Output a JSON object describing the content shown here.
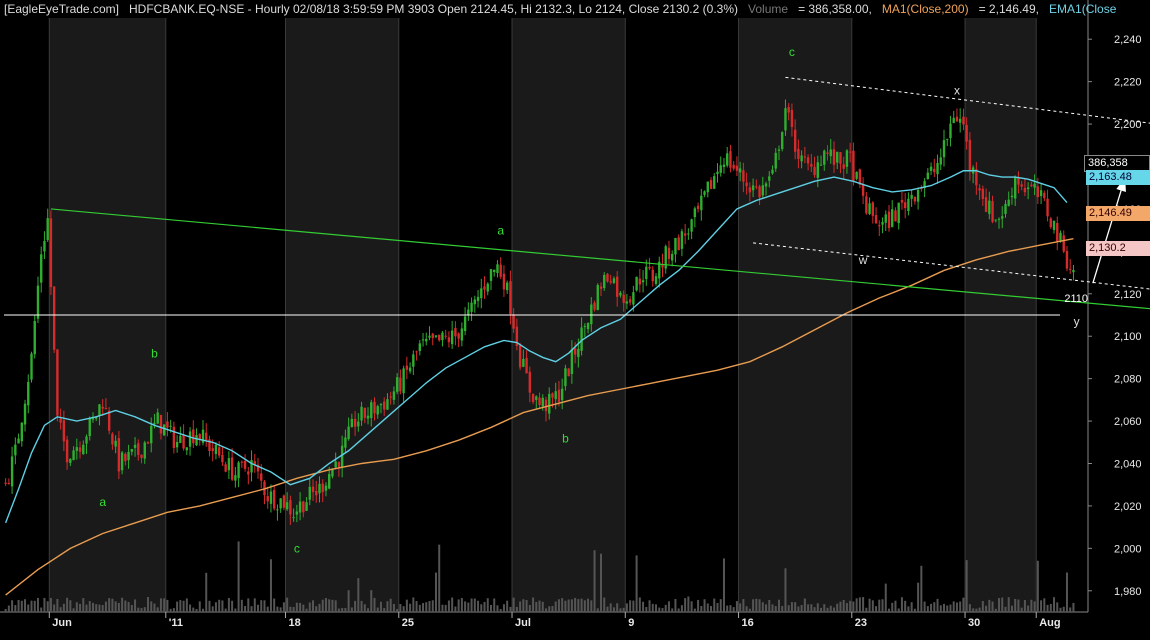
{
  "header": {
    "source": "[EagleEyeTrade.com]",
    "symbol_line": "HDFCBANK.EQ-NSE - Hourly 02/08/18 3:59:59 PM 3903 Open 2124.45, Hi 2132.3, Lo 2124, Close 2130.2 (0.3%)",
    "volume_label": "Volume",
    "volume_value": "= 386,358.00,",
    "ma_label": "MA1(Close,200)",
    "ma_value": "= 2,146.49,",
    "ema_label": "EMA1(Close"
  },
  "tags": {
    "volume_tag": "386,358",
    "ema_tag": "2,163.48",
    "ma_tag": "2,146.49",
    "close_tag": "2,130.2",
    "level_label": "2110"
  },
  "colors": {
    "background": "#000000",
    "panel_band": "#1a1a1a",
    "up_candle": "#2fae2f",
    "down_candle": "#d62b2b",
    "ema": "#5fcfe3",
    "ma": "#e89c50",
    "trendline": "#33cc33",
    "channel": "#ffffff",
    "wave_label": "#33dd33"
  },
  "chart_data": {
    "type": "candlestick",
    "title": "HDFCBANK.EQ-NSE - Hourly",
    "ylim": [
      1970,
      2250
    ],
    "y_ticks": [
      1980,
      2000,
      2020,
      2040,
      2060,
      2080,
      2100,
      2120,
      2140,
      2160,
      2180,
      2200,
      2220,
      2240
    ],
    "y_tick_labels": [
      "1,980",
      "2,000",
      "2,020",
      "2,040",
      "2,060",
      "2,080",
      "2,100",
      "2,120",
      "2,140",
      "2,160",
      "2,180",
      "2,200",
      "2,220",
      "2,240"
    ],
    "x_labels": [
      {
        "text": "Jun",
        "bar": 14
      },
      {
        "text": "'11",
        "bar": 50
      },
      {
        "text": "18",
        "bar": 87
      },
      {
        "text": "25",
        "bar": 122
      },
      {
        "text": "Jul",
        "bar": 157
      },
      {
        "text": "9",
        "bar": 192
      },
      {
        "text": "16",
        "bar": 227
      },
      {
        "text": "23",
        "bar": 262
      },
      {
        "text": "30",
        "bar": 297
      },
      {
        "text": "Aug",
        "bar": 319
      }
    ],
    "price_path": [
      [
        0,
        2030
      ],
      [
        3,
        2045
      ],
      [
        8,
        2090
      ],
      [
        11,
        2140
      ],
      [
        13,
        2155
      ],
      [
        16,
        2060
      ],
      [
        19,
        2045
      ],
      [
        23,
        2050
      ],
      [
        27,
        2060
      ],
      [
        30,
        2070
      ],
      [
        35,
        2040
      ],
      [
        41,
        2045
      ],
      [
        47,
        2060
      ],
      [
        53,
        2050
      ],
      [
        59,
        2055
      ],
      [
        65,
        2045
      ],
      [
        71,
        2035
      ],
      [
        76,
        2040
      ],
      [
        81,
        2025
      ],
      [
        86,
        2022
      ],
      [
        89,
        2017
      ],
      [
        92,
        2022
      ],
      [
        97,
        2028
      ],
      [
        101,
        2038
      ],
      [
        104,
        2045
      ],
      [
        108,
        2060
      ],
      [
        113,
        2065
      ],
      [
        118,
        2070
      ],
      [
        123,
        2080
      ],
      [
        128,
        2095
      ],
      [
        133,
        2097
      ],
      [
        139,
        2100
      ],
      [
        144,
        2112
      ],
      [
        149,
        2128
      ],
      [
        152,
        2133
      ],
      [
        154,
        2127
      ],
      [
        156,
        2115
      ],
      [
        159,
        2090
      ],
      [
        162,
        2075
      ],
      [
        165,
        2068
      ],
      [
        168,
        2068
      ],
      [
        171,
        2073
      ],
      [
        174,
        2085
      ],
      [
        179,
        2105
      ],
      [
        184,
        2125
      ],
      [
        187,
        2130
      ],
      [
        190,
        2118
      ],
      [
        193,
        2120
      ],
      [
        197,
        2130
      ],
      [
        200,
        2128
      ],
      [
        205,
        2140
      ],
      [
        210,
        2148
      ],
      [
        214,
        2158
      ],
      [
        218,
        2172
      ],
      [
        222,
        2185
      ],
      [
        225,
        2180
      ],
      [
        229,
        2172
      ],
      [
        233,
        2168
      ],
      [
        237,
        2175
      ],
      [
        241,
        2208
      ],
      [
        243,
        2195
      ],
      [
        246,
        2182
      ],
      [
        249,
        2178
      ],
      [
        253,
        2187
      ],
      [
        257,
        2182
      ],
      [
        261,
        2183
      ],
      [
        264,
        2168
      ],
      [
        267,
        2158
      ],
      [
        271,
        2152
      ],
      [
        275,
        2158
      ],
      [
        279,
        2165
      ],
      [
        283,
        2172
      ],
      [
        287,
        2178
      ],
      [
        290,
        2188
      ],
      [
        293,
        2205
      ],
      [
        296,
        2200
      ],
      [
        298,
        2180
      ],
      [
        301,
        2172
      ],
      [
        303,
        2162
      ],
      [
        306,
        2155
      ],
      [
        309,
        2160
      ],
      [
        312,
        2175
      ],
      [
        315,
        2170
      ],
      [
        318,
        2168
      ],
      [
        321,
        2162
      ],
      [
        324,
        2152
      ],
      [
        327,
        2140
      ],
      [
        330,
        2130
      ]
    ],
    "ema_path": [
      [
        0,
        2012
      ],
      [
        4,
        2028
      ],
      [
        8,
        2045
      ],
      [
        12,
        2058
      ],
      [
        16,
        2062
      ],
      [
        22,
        2060
      ],
      [
        28,
        2062
      ],
      [
        34,
        2065
      ],
      [
        40,
        2062
      ],
      [
        46,
        2058
      ],
      [
        52,
        2055
      ],
      [
        58,
        2052
      ],
      [
        64,
        2050
      ],
      [
        70,
        2046
      ],
      [
        76,
        2040
      ],
      [
        82,
        2036
      ],
      [
        88,
        2030
      ],
      [
        94,
        2033
      ],
      [
        100,
        2040
      ],
      [
        106,
        2046
      ],
      [
        112,
        2054
      ],
      [
        118,
        2062
      ],
      [
        124,
        2070
      ],
      [
        130,
        2078
      ],
      [
        136,
        2085
      ],
      [
        142,
        2090
      ],
      [
        148,
        2095
      ],
      [
        154,
        2098
      ],
      [
        158,
        2097
      ],
      [
        162,
        2093
      ],
      [
        166,
        2090
      ],
      [
        170,
        2088
      ],
      [
        174,
        2092
      ],
      [
        178,
        2098
      ],
      [
        184,
        2104
      ],
      [
        190,
        2108
      ],
      [
        196,
        2116
      ],
      [
        202,
        2124
      ],
      [
        208,
        2131
      ],
      [
        214,
        2140
      ],
      [
        220,
        2150
      ],
      [
        226,
        2160
      ],
      [
        232,
        2164
      ],
      [
        238,
        2167
      ],
      [
        244,
        2170
      ],
      [
        250,
        2173
      ],
      [
        256,
        2175
      ],
      [
        262,
        2173
      ],
      [
        268,
        2170
      ],
      [
        274,
        2168
      ],
      [
        280,
        2169
      ],
      [
        286,
        2171
      ],
      [
        292,
        2175
      ],
      [
        296,
        2178
      ],
      [
        300,
        2178
      ],
      [
        304,
        2176
      ],
      [
        308,
        2175
      ],
      [
        312,
        2175
      ],
      [
        316,
        2174
      ],
      [
        320,
        2172
      ],
      [
        324,
        2170
      ],
      [
        328,
        2163
      ]
    ],
    "ma_path": [
      [
        0,
        1978
      ],
      [
        10,
        1990
      ],
      [
        20,
        2000
      ],
      [
        30,
        2007
      ],
      [
        40,
        2012
      ],
      [
        50,
        2017
      ],
      [
        60,
        2020
      ],
      [
        70,
        2024
      ],
      [
        80,
        2028
      ],
      [
        90,
        2033
      ],
      [
        100,
        2037
      ],
      [
        110,
        2040
      ],
      [
        120,
        2042
      ],
      [
        130,
        2046
      ],
      [
        140,
        2051
      ],
      [
        150,
        2057
      ],
      [
        160,
        2064
      ],
      [
        170,
        2068
      ],
      [
        180,
        2072
      ],
      [
        190,
        2075
      ],
      [
        200,
        2078
      ],
      [
        210,
        2081
      ],
      [
        220,
        2084
      ],
      [
        230,
        2088
      ],
      [
        240,
        2095
      ],
      [
        250,
        2103
      ],
      [
        260,
        2111
      ],
      [
        270,
        2118
      ],
      [
        280,
        2124
      ],
      [
        290,
        2131
      ],
      [
        300,
        2136
      ],
      [
        310,
        2140
      ],
      [
        320,
        2143
      ],
      [
        330,
        2146
      ]
    ],
    "trendline_green": [
      [
        14,
        2160
      ],
      [
        368,
        2111
      ]
    ],
    "horizontal_level": {
      "y": 2110,
      "label": "2110"
    },
    "channel_upper": [
      [
        241,
        2222
      ],
      [
        382,
        2195
      ]
    ],
    "channel_lower": [
      [
        231,
        2144
      ],
      [
        372,
        2119
      ]
    ],
    "arrow": {
      "from": [
        336,
        2125
      ],
      "to": [
        346,
        2175
      ]
    },
    "wave_labels": [
      {
        "text": "a",
        "bar": 30,
        "y": 2020,
        "color": "green"
      },
      {
        "text": "b",
        "bar": 46,
        "y": 2090,
        "color": "green"
      },
      {
        "text": "c",
        "bar": 90,
        "y": 1998,
        "color": "green"
      },
      {
        "text": "a",
        "bar": 153,
        "y": 2148,
        "color": "green"
      },
      {
        "text": "b",
        "bar": 173,
        "y": 2050,
        "color": "green"
      },
      {
        "text": "c",
        "bar": 243,
        "y": 2232,
        "color": "green"
      },
      {
        "text": "w",
        "bar": 265,
        "y": 2134,
        "color": "white"
      },
      {
        "text": "x",
        "bar": 294,
        "y": 2214,
        "color": "white"
      },
      {
        "text": "y",
        "bar": 331,
        "y": 2105,
        "color": "white"
      }
    ]
  }
}
